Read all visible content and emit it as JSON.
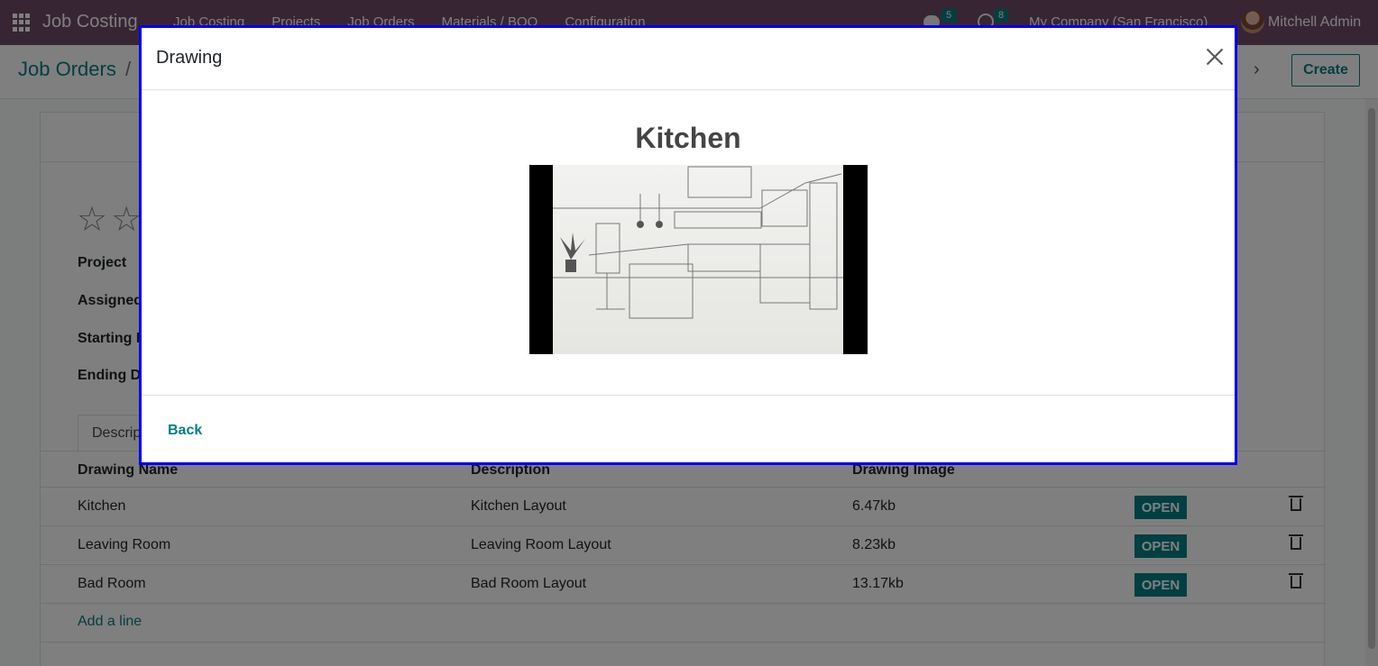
{
  "navbar": {
    "brand": "Job Costing",
    "menu": [
      "Job Costing",
      "Projects",
      "Job Orders",
      "Materials / BOQ",
      "Configuration"
    ],
    "messages_count": "5",
    "activities_count": "8",
    "company": "My Company (San Francisco)",
    "user": "Mitchell Admin"
  },
  "control": {
    "breadcrumb": "Job Orders",
    "breadcrumb_sep": "/",
    "create_label": "Create",
    "next_label": "›"
  },
  "form": {
    "labels": [
      "Project",
      "Assigned",
      "Starting D",
      "Ending D"
    ],
    "tab_label": "Descrip",
    "table": {
      "headers": [
        "Drawing Name",
        "Description",
        "Drawing Image"
      ],
      "rows": [
        {
          "name": "Kitchen",
          "description": "Kitchen Layout",
          "size": "6.47kb",
          "action": "OPEN"
        },
        {
          "name": "Leaving Room",
          "description": "Leaving Room Layout",
          "size": "8.23kb",
          "action": "OPEN"
        },
        {
          "name": "Bad Room",
          "description": "Bad Room Layout",
          "size": "13.17kb",
          "action": "OPEN"
        }
      ],
      "add_line": "Add a line"
    }
  },
  "modal": {
    "title": "Drawing",
    "drawing_name": "Kitchen",
    "back_label": "Back"
  }
}
